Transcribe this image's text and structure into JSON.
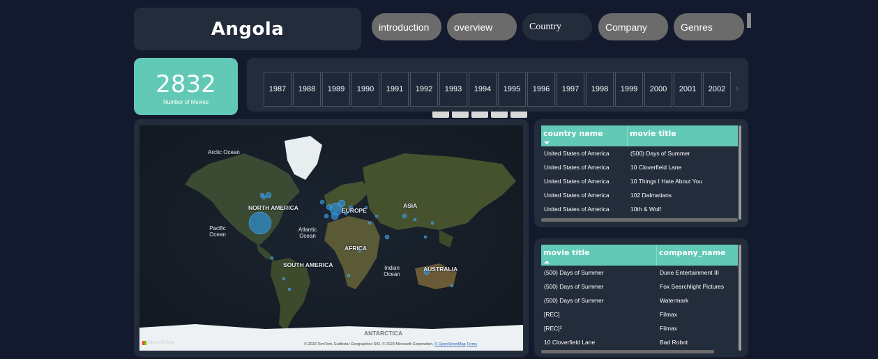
{
  "header": {
    "title": "Angola"
  },
  "nav": [
    {
      "label": "introduction",
      "active": false
    },
    {
      "label": "overview",
      "active": false
    },
    {
      "label": "Country",
      "active": true
    },
    {
      "label": "Company",
      "active": false
    },
    {
      "label": "Genres",
      "active": false
    }
  ],
  "kpi": {
    "value": "2832",
    "label": "Number of Movies"
  },
  "years": [
    "1987",
    "1988",
    "1989",
    "1990",
    "1991",
    "1992",
    "1993",
    "1994",
    "1995",
    "1996",
    "1997",
    "1998",
    "1999",
    "2000",
    "2001",
    "2002"
  ],
  "year_next_icon": "chevron-right-icon",
  "map": {
    "labels": {
      "arctic": "Arctic Ocean",
      "north_america": "NORTH AMERICA",
      "europe": "EUROPE",
      "asia": "ASIA",
      "pacific": "Pacific Ocean",
      "atlantic": "Atlantic Ocean",
      "africa": "AFRICA",
      "south_america": "SOUTH AMERICA",
      "indian": "Indian Ocean",
      "australia": "AUSTRALIA",
      "antarctica": "ANTARCTICA"
    },
    "bing_label": "Microsoft Bing",
    "copyright": "© 2023 TomTom, Earthstar Geographics SIO, © 2023 Microsoft Corporation,",
    "osm": "© OpenStreetMap",
    "terms": "Terms",
    "bubble_color": "#2d8fd5"
  },
  "table_country": {
    "columns": [
      "country name",
      "movie title"
    ],
    "sort": "down",
    "rows": [
      [
        "United States of America",
        "(500) Days of Summer"
      ],
      [
        "United States of America",
        "10 Cloverfield Lane"
      ],
      [
        "United States of America",
        "10 Things I Hate About You"
      ],
      [
        "United States of America",
        "102 Dalmatians"
      ],
      [
        "United States of America",
        "10th & Wolf"
      ]
    ]
  },
  "table_company": {
    "columns": [
      "movie title",
      "company_name"
    ],
    "sort": "up",
    "rows": [
      [
        "(500) Days of Summer",
        "Dune Entertainment III"
      ],
      [
        "(500) Days of Summer",
        "Fox Searchlight Pictures"
      ],
      [
        "(500) Days of Summer",
        "Watermark"
      ],
      [
        "[REC]",
        "Filmax"
      ],
      [
        "[REC]²",
        "Filmax"
      ],
      [
        "10 Cloverfield Lane",
        "Bad Robot"
      ]
    ]
  },
  "colors": {
    "accent": "#62c9b6",
    "panel": "#232c3b",
    "background": "#141a2e",
    "nav_inactive": "#6b6b6b"
  }
}
